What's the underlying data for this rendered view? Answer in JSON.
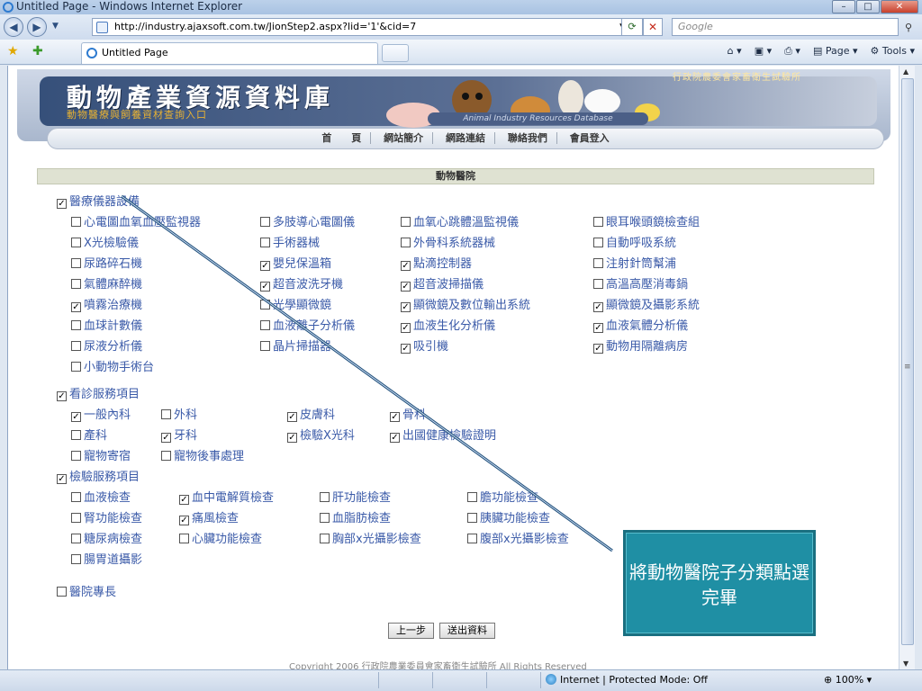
{
  "window": {
    "title": "Untitled Page - Windows Internet Explorer",
    "minimize": "–",
    "maximize": "□",
    "close": "✕"
  },
  "address": {
    "url": "http://industry.ajaxsoft.com.tw/JionStep2.aspx?lid='1'&cid=7",
    "search_placeholder": "Google"
  },
  "tab": {
    "title": "Untitled Page"
  },
  "toolbar": {
    "page": "Page",
    "tools": "Tools"
  },
  "banner": {
    "title": "動物產業資源資料庫",
    "subtitle": "動物醫療與飼養資材查詢入口",
    "agency": "行政院農委會家畜衛生試驗所",
    "english": "Animal Industry Resources Database"
  },
  "nav": {
    "items": [
      "首　　頁",
      "網站簡介",
      "網路連結",
      "聯絡我們",
      "會員登入"
    ]
  },
  "form": {
    "header": "動物醫院",
    "groups": [
      {
        "label": "醫療儀器設備",
        "checked": true
      },
      {
        "label": "看診服務項目",
        "checked": true
      },
      {
        "label": "檢驗服務項目",
        "checked": true
      },
      {
        "label": "醫院專長",
        "checked": false
      }
    ],
    "equipment": [
      {
        "label": "心電圖血氧血壓監視器",
        "checked": false
      },
      {
        "label": "多肢導心電圖儀",
        "checked": false
      },
      {
        "label": "血氧心跳體溫監視儀",
        "checked": false
      },
      {
        "label": "眼耳喉頭鏡檢查組",
        "checked": false
      },
      {
        "label": "X光檢驗儀",
        "checked": false
      },
      {
        "label": "手術器械",
        "checked": false
      },
      {
        "label": "外骨科系統器械",
        "checked": false
      },
      {
        "label": "自動呼吸系統",
        "checked": false
      },
      {
        "label": "尿路碎石機",
        "checked": false
      },
      {
        "label": "嬰兒保溫箱",
        "checked": true
      },
      {
        "label": "點滴控制器",
        "checked": true
      },
      {
        "label": "注射針筒幫浦",
        "checked": false
      },
      {
        "label": "氣體麻醉機",
        "checked": false
      },
      {
        "label": "超音波洗牙機",
        "checked": true
      },
      {
        "label": "超音波掃描儀",
        "checked": true
      },
      {
        "label": "高溫高壓消毒鍋",
        "checked": false
      },
      {
        "label": "噴霧治療機",
        "checked": true
      },
      {
        "label": "光學顯微鏡",
        "checked": false
      },
      {
        "label": "顯微鏡及數位輸出系統",
        "checked": true
      },
      {
        "label": "顯微鏡及攝影系統",
        "checked": true
      },
      {
        "label": "血球計數儀",
        "checked": false
      },
      {
        "label": "血液離子分析儀",
        "checked": false
      },
      {
        "label": "血液生化分析儀",
        "checked": true
      },
      {
        "label": "血液氣體分析儀",
        "checked": true
      },
      {
        "label": "尿液分析儀",
        "checked": false
      },
      {
        "label": "晶片掃描器",
        "checked": false
      },
      {
        "label": "吸引機",
        "checked": true
      },
      {
        "label": "動物用隔離病房",
        "checked": true
      },
      {
        "label": "小動物手術台",
        "checked": false
      }
    ],
    "services": [
      {
        "label": "一般內科",
        "checked": true
      },
      {
        "label": "外科",
        "checked": false
      },
      {
        "label": "皮膚科",
        "checked": true
      },
      {
        "label": "骨科",
        "checked": true
      },
      {
        "label": "產科",
        "checked": false
      },
      {
        "label": "牙科",
        "checked": true
      },
      {
        "label": "檢驗X光科",
        "checked": true
      },
      {
        "label": "出國健康檢驗證明",
        "checked": true
      },
      {
        "label": "寵物寄宿",
        "checked": false
      },
      {
        "label": "寵物後事處理",
        "checked": false
      }
    ],
    "tests": [
      {
        "label": "血液檢查",
        "checked": false
      },
      {
        "label": "血中電解質檢查",
        "checked": true
      },
      {
        "label": "肝功能檢查",
        "checked": false
      },
      {
        "label": "膽功能檢查",
        "checked": false
      },
      {
        "label": "腎功能檢查",
        "checked": false
      },
      {
        "label": "痛風檢查",
        "checked": true
      },
      {
        "label": "血脂肪檢查",
        "checked": false
      },
      {
        "label": "胰臟功能檢查",
        "checked": false
      },
      {
        "label": "糖尿病檢查",
        "checked": false
      },
      {
        "label": "心臟功能檢查",
        "checked": false
      },
      {
        "label": "胸部x光攝影檢查",
        "checked": false
      },
      {
        "label": "腹部x光攝影檢查",
        "checked": false
      },
      {
        "label": "腸胃道攝影",
        "checked": false
      }
    ],
    "prev_button": "上一步",
    "submit_button": "送出資料"
  },
  "copyright": "Copyright 2006 行政院農業委員會家畜衛生試驗所 All Rights Reserved",
  "callout": {
    "text": "將動物醫院子分類點選完畢"
  },
  "status": {
    "mode": "Internet | Protected Mode: Off",
    "zoom": "100%"
  },
  "colors": {
    "link_text": "#3a5aa8",
    "callout_bg": "#1f8fa4",
    "arrow": "#1f4f7a"
  }
}
